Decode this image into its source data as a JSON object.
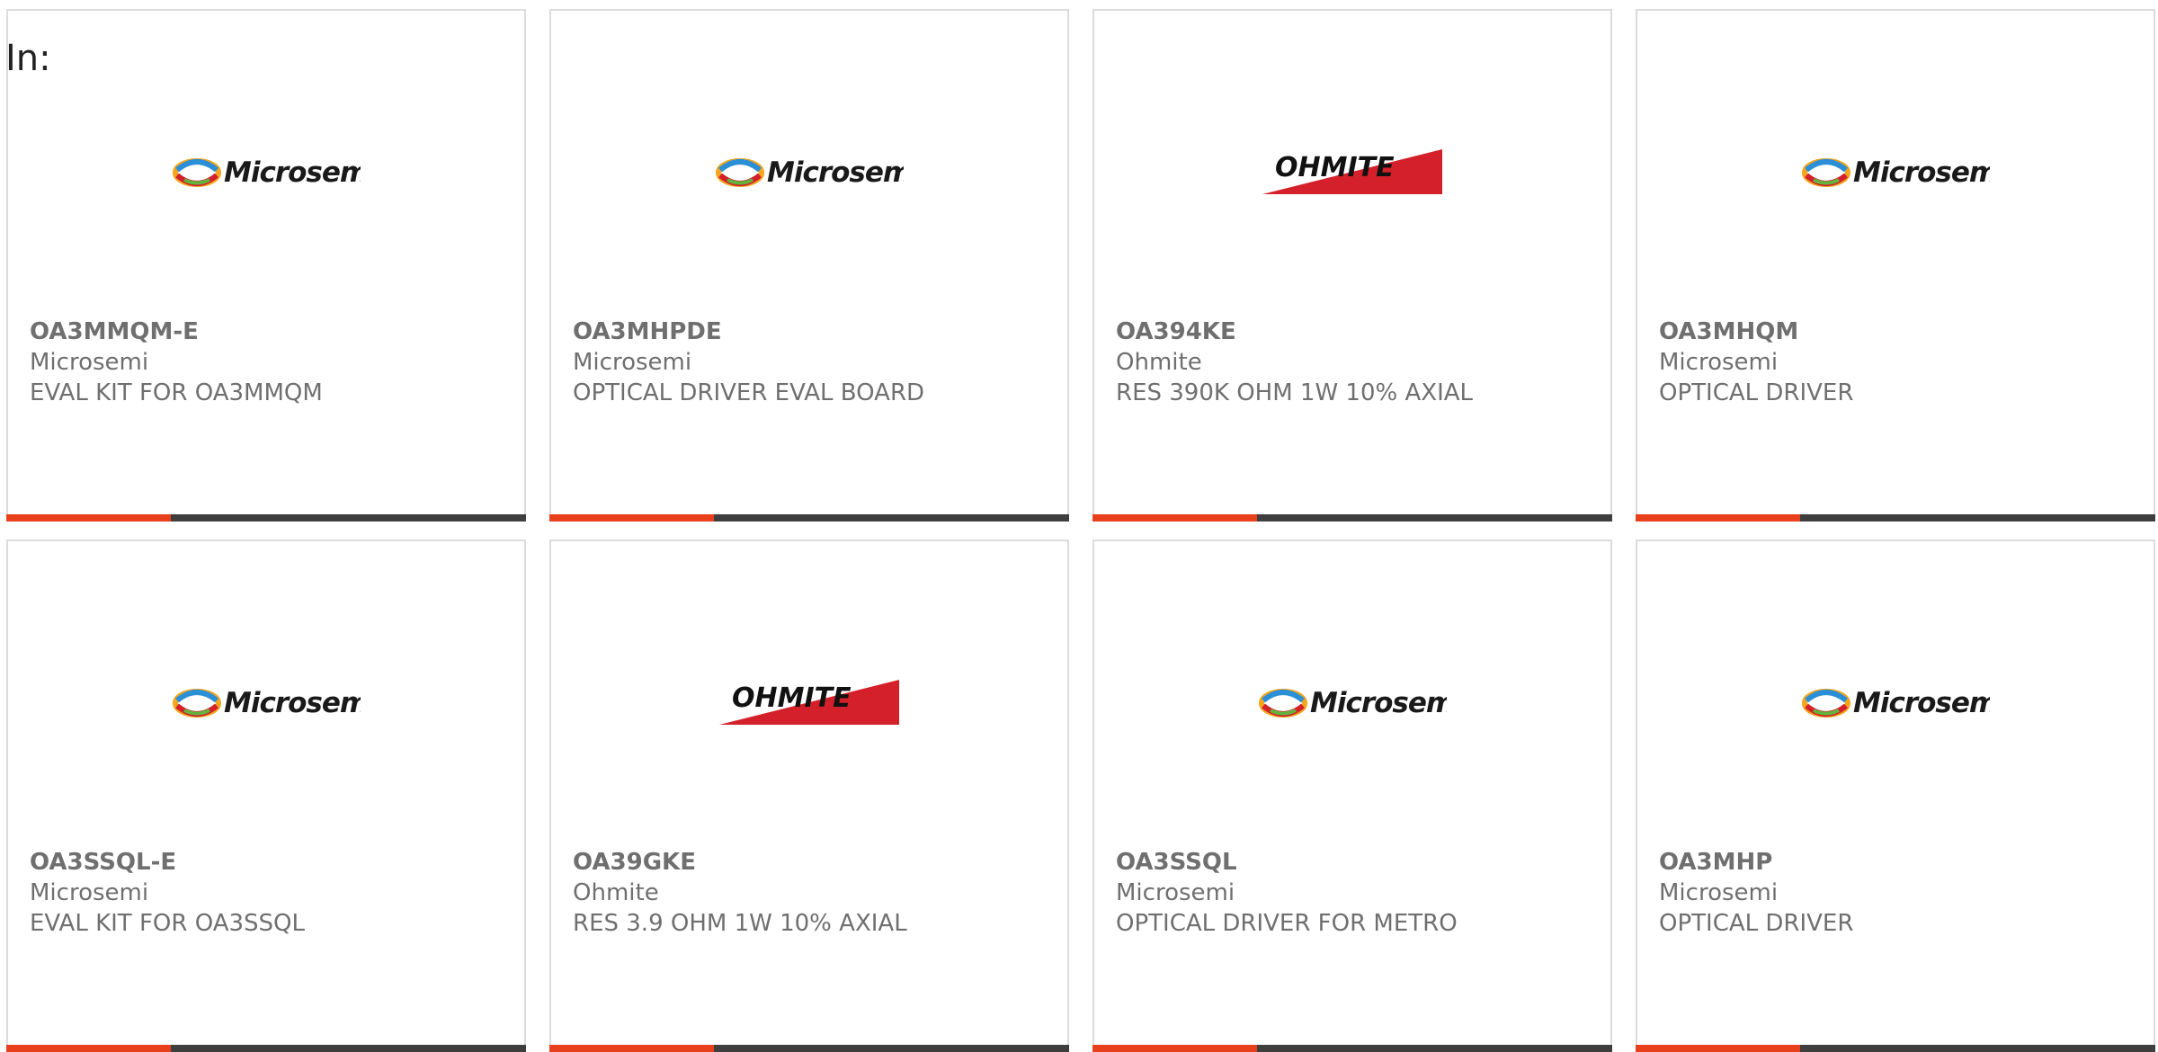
{
  "header": {
    "label": "In:"
  },
  "colors": {
    "accent_bar": "#e8401c",
    "rest_bar": "#3e3e3e",
    "text": "#6f6f6f",
    "ohmite_red": "#d3202a"
  },
  "products": [
    {
      "part_number": "OA3MMQM-E",
      "manufacturer": "Microsemi",
      "description": "EVAL KIT FOR OA3MMQM",
      "logo": "Microsemi"
    },
    {
      "part_number": "OA3MHPDE",
      "manufacturer": "Microsemi",
      "description": "OPTICAL DRIVER EVAL BOARD",
      "logo": "Microsemi"
    },
    {
      "part_number": "OA394KE",
      "manufacturer": "Ohmite",
      "description": "RES 390K OHM 1W 10% AXIAL",
      "logo": "OHMITE"
    },
    {
      "part_number": "OA3MHQM",
      "manufacturer": "Microsemi",
      "description": "OPTICAL DRIVER",
      "logo": "Microsemi"
    },
    {
      "part_number": "OA3SSQL-E",
      "manufacturer": "Microsemi",
      "description": "EVAL KIT FOR OA3SSQL",
      "logo": "Microsemi"
    },
    {
      "part_number": "OA39GKE",
      "manufacturer": "Ohmite",
      "description": "RES 3.9 OHM 1W 10% AXIAL",
      "logo": "OHMITE"
    },
    {
      "part_number": "OA3SSQL",
      "manufacturer": "Microsemi",
      "description": "OPTICAL DRIVER FOR METRO",
      "logo": "Microsemi"
    },
    {
      "part_number": "OA3MHP",
      "manufacturer": "Microsemi",
      "description": "OPTICAL DRIVER",
      "logo": "Microsemi"
    }
  ]
}
